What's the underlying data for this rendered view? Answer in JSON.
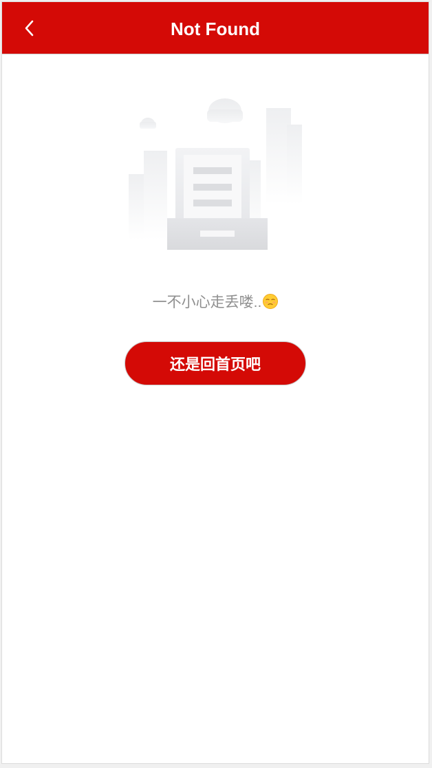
{
  "header": {
    "title": "Not Found",
    "back_icon": "chevron-left-icon"
  },
  "content": {
    "message": "一不小心走丢喽..",
    "emoji_icon": "unamused-face-icon",
    "home_button_label": "还是回首页吧"
  },
  "colors": {
    "brand_red": "#d40a06",
    "message_gray": "#8f8f8f",
    "illustration_gray": "#dcdde0"
  }
}
